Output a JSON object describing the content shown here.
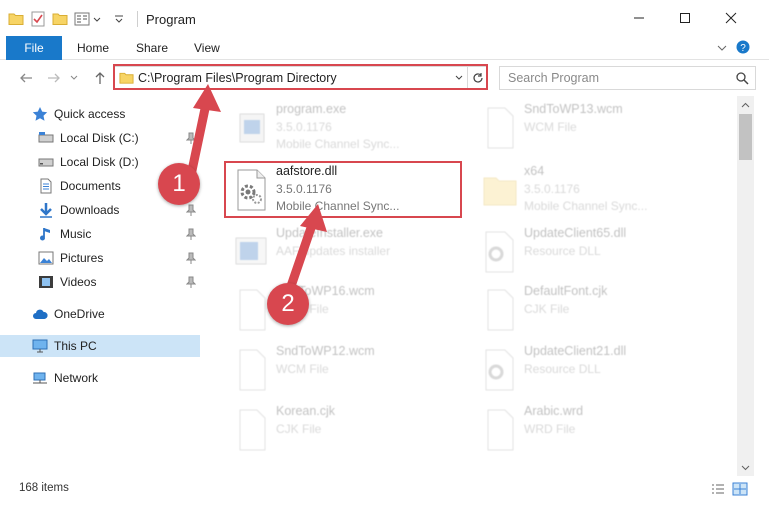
{
  "window": {
    "title": "Program"
  },
  "ribbon": {
    "file": "File",
    "home": "Home",
    "share": "Share",
    "view": "View"
  },
  "address": {
    "path": "C:\\Program Files\\Program Directory"
  },
  "search": {
    "placeholder": "Search Program"
  },
  "nav": {
    "quick_access": "Quick access",
    "local_c": "Local Disk (C:)",
    "local_d": "Local Disk (D:)",
    "documents": "Documents",
    "downloads": "Downloads",
    "music": "Music",
    "pictures": "Pictures",
    "videos": "Videos",
    "onedrive": "OneDrive",
    "this_pc": "This PC",
    "network": "Network"
  },
  "files": [
    {
      "name": "program.exe",
      "version": "3.5.0.1176",
      "type": "Mobile Channel Sync..."
    },
    {
      "name": "SndToWP13.wcm",
      "version": "",
      "type": "WCM File"
    },
    {
      "name": "aafstore.dll",
      "version": "3.5.0.1176",
      "type": "Mobile Channel Sync..."
    },
    {
      "name": "x64",
      "version": "3.5.0.1176",
      "type": "Mobile Channel Sync..."
    },
    {
      "name": "UpdateInstaller.exe",
      "version": "",
      "type": "AAF updates installer"
    },
    {
      "name": "UpdateClient65.dll",
      "version": "",
      "type": "Resource DLL"
    },
    {
      "name": "SndToWP16.wcm",
      "version": "",
      "type": "WCM File"
    },
    {
      "name": "DefaultFont.cjk",
      "version": "",
      "type": "CJK File"
    },
    {
      "name": "SndToWP12.wcm",
      "version": "",
      "type": "WCM File"
    },
    {
      "name": "UpdateClient21.dll",
      "version": "",
      "type": "Resource DLL"
    },
    {
      "name": "Korean.cjk",
      "version": "",
      "type": "CJK File"
    },
    {
      "name": "Arabic.wrd",
      "version": "",
      "type": "WRD File"
    }
  ],
  "status": {
    "items": "168 items"
  },
  "annotations": {
    "step1": "1",
    "step2": "2"
  },
  "colors": {
    "accent": "#1979ca",
    "highlight": "#d8474f",
    "selected": "#cce4f7"
  }
}
